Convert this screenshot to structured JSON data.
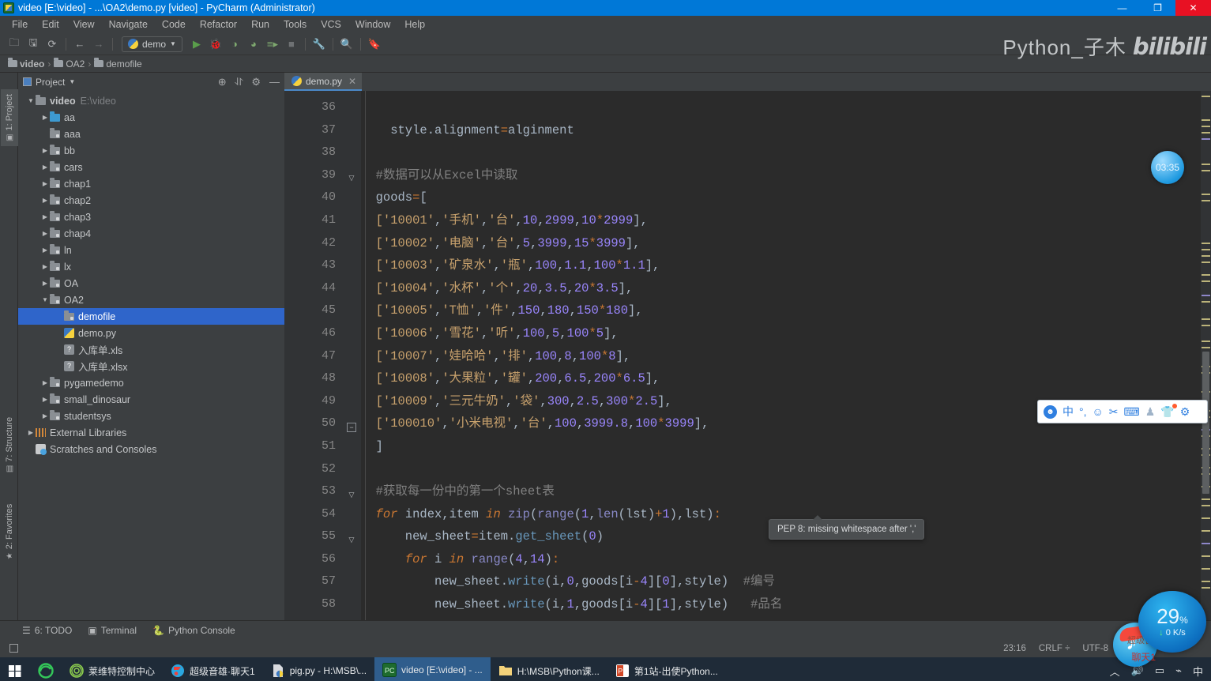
{
  "window": {
    "title": "video [E:\\video] - ...\\OA2\\demo.py [video] - PyCharm (Administrator)",
    "minimize": "—",
    "maximize": "❐",
    "close": "✕"
  },
  "menu": [
    "File",
    "Edit",
    "View",
    "Navigate",
    "Code",
    "Refactor",
    "Run",
    "Tools",
    "VCS",
    "Window",
    "Help"
  ],
  "toolbar": {
    "run_config": "demo",
    "watermark_text": "Python_子木",
    "watermark_brand": "bilibili",
    "icons": [
      "open-folder-icon",
      "save-icon",
      "sync-icon",
      "back-arrow-icon",
      "forward-arrow-icon",
      "run-icon",
      "debug-icon",
      "run-coverage-icon",
      "profile-icon",
      "run-dashboard-icon",
      "stop-icon",
      "settings-wrench-icon",
      "search-icon",
      "toggle-bookmark-icon"
    ]
  },
  "breadcrumb": [
    "video",
    "OA2",
    "demofile"
  ],
  "left_rail": [
    {
      "label": "1: Project",
      "active": true
    },
    {
      "label": "7: Structure",
      "active": false
    },
    {
      "label": "2: Favorites",
      "active": false
    }
  ],
  "project": {
    "panel_title": "Project",
    "header_icons": [
      "locate-icon",
      "collapse-all-icon",
      "gear-icon",
      "hide-icon"
    ],
    "tree": [
      {
        "label": "video",
        "hint": "E:\\video",
        "depth": 0,
        "arrow": "▼",
        "icon": "folder",
        "bold": true
      },
      {
        "label": "aa",
        "depth": 1,
        "arrow": "▶",
        "icon": "folder-blue"
      },
      {
        "label": "aaa",
        "depth": 1,
        "arrow": "",
        "icon": "folder-module"
      },
      {
        "label": "bb",
        "depth": 1,
        "arrow": "▶",
        "icon": "folder-module"
      },
      {
        "label": "cars",
        "depth": 1,
        "arrow": "▶",
        "icon": "folder-module"
      },
      {
        "label": "chap1",
        "depth": 1,
        "arrow": "▶",
        "icon": "folder-module"
      },
      {
        "label": "chap2",
        "depth": 1,
        "arrow": "▶",
        "icon": "folder-module"
      },
      {
        "label": "chap3",
        "depth": 1,
        "arrow": "▶",
        "icon": "folder-module"
      },
      {
        "label": "chap4",
        "depth": 1,
        "arrow": "▶",
        "icon": "folder-module"
      },
      {
        "label": "ln",
        "depth": 1,
        "arrow": "▶",
        "icon": "folder-module"
      },
      {
        "label": "lx",
        "depth": 1,
        "arrow": "▶",
        "icon": "folder-module"
      },
      {
        "label": "OA",
        "depth": 1,
        "arrow": "▶",
        "icon": "folder-module"
      },
      {
        "label": "OA2",
        "depth": 1,
        "arrow": "▼",
        "icon": "folder-module"
      },
      {
        "label": "demofile",
        "depth": 2,
        "arrow": "",
        "icon": "folder-module",
        "selected": true
      },
      {
        "label": "demo.py",
        "depth": 2,
        "arrow": "",
        "icon": "python-file"
      },
      {
        "label": "入库单.xls",
        "depth": 2,
        "arrow": "",
        "icon": "unknown-file"
      },
      {
        "label": "入库单.xlsx",
        "depth": 2,
        "arrow": "",
        "icon": "unknown-file"
      },
      {
        "label": "pygamedemo",
        "depth": 1,
        "arrow": "▶",
        "icon": "folder-module"
      },
      {
        "label": "small_dinosaur",
        "depth": 1,
        "arrow": "▶",
        "icon": "folder-module"
      },
      {
        "label": "studentsys",
        "depth": 1,
        "arrow": "▶",
        "icon": "folder-module"
      },
      {
        "label": "External Libraries",
        "depth": 0,
        "arrow": "▶",
        "icon": "library"
      },
      {
        "label": "Scratches and Consoles",
        "depth": 0,
        "arrow": "",
        "icon": "scratches"
      }
    ]
  },
  "editor": {
    "tab": {
      "label": "demo.py",
      "close": "✕"
    },
    "first_line": 36,
    "tooltip": "PEP 8: missing whitespace after ','",
    "timer_badge": "03:35",
    "lines": [
      {
        "no": 36,
        "html": ""
      },
      {
        "no": 37,
        "html": "    style.alignment<span class=\"eq\">=</span>alginment"
      },
      {
        "no": 38,
        "html": ""
      },
      {
        "no": 39,
        "html": "  <span class=\"cm\">#数据可以从Excel中读取</span>"
      },
      {
        "no": 40,
        "html": "  goods<span class=\"eq\">=</span>["
      },
      {
        "no": 41,
        "html": "  <span class=\"s\">[&#39;10001&#39;</span>,<span class=\"s\">&#39;手机&#39;</span>,<span class=\"s\">&#39;台&#39;</span>,<span class=\"n\">10</span>,<span class=\"n\">2999</span>,<span class=\"n\">10</span><span class=\"op\">*</span><span class=\"n\">2999</span>],"
      },
      {
        "no": 42,
        "html": "  <span class=\"s\">[&#39;10002&#39;</span>,<span class=\"s\">&#39;电脑&#39;</span>,<span class=\"s\">&#39;台&#39;</span>,<span class=\"n\">5</span>,<span class=\"n\">3999</span>,<span class=\"n\">15</span><span class=\"op\">*</span><span class=\"n\">3999</span>],"
      },
      {
        "no": 43,
        "html": "  <span class=\"s\">[&#39;10003&#39;</span>,<span class=\"s\">&#39;矿泉水&#39;</span>,<span class=\"s\">&#39;瓶&#39;</span>,<span class=\"n\">100</span>,<span class=\"n\">1.1</span>,<span class=\"n\">100</span><span class=\"op\">*</span><span class=\"n\">1.1</span>],"
      },
      {
        "no": 44,
        "html": "  <span class=\"s\">[&#39;10004&#39;</span>,<span class=\"s\">&#39;水杯&#39;</span>,<span class=\"s\">&#39;个&#39;</span>,<span class=\"n\">20</span>,<span class=\"n\">3.5</span>,<span class=\"n\">20</span><span class=\"op\">*</span><span class=\"n\">3.5</span>],"
      },
      {
        "no": 45,
        "html": "  <span class=\"s\">[&#39;10005&#39;</span>,<span class=\"s\">&#39;T恤&#39;</span>,<span class=\"s\">&#39;件&#39;</span>,<span class=\"n\">150</span>,<span class=\"n\">180</span>,<span class=\"n\">150</span><span class=\"op\">*</span><span class=\"n\">180</span>],"
      },
      {
        "no": 46,
        "html": "  <span class=\"s\">[&#39;10006&#39;</span>,<span class=\"s\">&#39;雪花&#39;</span>,<span class=\"s\">&#39;听&#39;</span>,<span class=\"n\">100</span>,<span class=\"n\">5</span>,<span class=\"n\">100</span><span class=\"op\">*</span><span class=\"n\">5</span>],"
      },
      {
        "no": 47,
        "html": "  <span class=\"s\">[&#39;10007&#39;</span>,<span class=\"s\">&#39;娃哈哈&#39;</span>,<span class=\"s\">&#39;排&#39;</span>,<span class=\"n\">100</span>,<span class=\"n\">8</span>,<span class=\"n\">100</span><span class=\"op\">*</span><span class=\"n\">8</span>],"
      },
      {
        "no": 48,
        "html": "  <span class=\"s\">[&#39;10008&#39;</span>,<span class=\"s\">&#39;大果粒&#39;</span>,<span class=\"s\">&#39;罐&#39;</span>,<span class=\"n\">200</span>,<span class=\"n\">6.5</span>,<span class=\"n\">200</span><span class=\"op\">*</span><span class=\"n\">6.5</span>],"
      },
      {
        "no": 49,
        "html": "  <span class=\"s\">[&#39;10009&#39;</span>,<span class=\"s\">&#39;三元牛奶&#39;</span>,<span class=\"s\">&#39;袋&#39;</span>,<span class=\"n\">300</span>,<span class=\"n\">2.5</span>,<span class=\"n\">300</span><span class=\"op\">*</span><span class=\"n\">2.5</span>],"
      },
      {
        "no": 50,
        "html": "  <span class=\"s\">[&#39;100010&#39;</span>,<span class=\"s\">&#39;小米电视&#39;</span>,<span class=\"s\">&#39;台&#39;</span>,<span class=\"n\">100</span>,<span class=\"n\">3999.8</span>,<span class=\"n\">100</span><span class=\"op\">*</span><span class=\"n\">3999</span>],"
      },
      {
        "no": 51,
        "html": "  ]"
      },
      {
        "no": 52,
        "html": ""
      },
      {
        "no": 53,
        "html": "  <span class=\"cm\">#获取每一份中的第一个sheet表</span>"
      },
      {
        "no": 54,
        "html": "  <span class=\"kw\">for</span> index,item <span class=\"kw\">in</span> <span class=\"bi\">zip</span>(<span class=\"bi\">range</span>(<span class=\"n\">1</span>,<span class=\"bi\">len</span>(lst)<span class=\"op\">+</span><span class=\"n\">1</span>),lst)<span class=\"op\">:</span>"
      },
      {
        "no": 55,
        "html": "      new_sheet<span class=\"eq\">=</span>item.<span class=\"fn\">get_sheet</span>(<span class=\"n\">0</span>)"
      },
      {
        "no": 56,
        "html": "      <span class=\"kw\">for</span> i <span class=\"kw\">in</span> <span class=\"bi\">range</span>(<span class=\"n\">4</span>,<span class=\"n\">14</span>)<span class=\"op\">:</span>"
      },
      {
        "no": 57,
        "html": "          new_sheet.<span class=\"fn\">write</span>(i,<span class=\"n\">0</span>,goods[i<span class=\"op\">-</span><span class=\"n\">4</span>][<span class=\"n\">0</span>],style)  <span class=\"cm\">#编号</span>"
      },
      {
        "no": 58,
        "html": "          new_sheet.<span class=\"fn\">write</span>(i,<span class=\"n\">1</span>,goods[i<span class=\"op\">-</span><span class=\"n\">4</span>][<span class=\"n\">1</span>],style)   <span class=\"cm\">#品名</span>"
      }
    ]
  },
  "bottom_tools": [
    {
      "label": "6: TODO",
      "icon": "todo-icon"
    },
    {
      "label": "Terminal",
      "icon": "terminal-icon"
    },
    {
      "label": "Python Console",
      "icon": "python-icon"
    }
  ],
  "status": {
    "time": "23:16",
    "line_sep": "CRLF",
    "encoding": "UTF-8",
    "sep_arrows": "÷"
  },
  "ime_toolbar": {
    "icons": [
      "sogou-logo-icon",
      "chinese-mode-icon",
      "punctuation-icon",
      "emoji-icon",
      "scissors-icon",
      "keyboard-icon",
      "user-icon",
      "skin-shirt-icon",
      "gear-icon"
    ],
    "chinese_label": "中"
  },
  "overlays": {
    "net_percent": "29",
    "net_percent_unit": "%",
    "net_speed": "0 K/s",
    "chat_label": "聊天1",
    "super_label": "超级音雄"
  },
  "taskbar": {
    "items": [
      {
        "label": "",
        "icon": "windows-start-icon",
        "type": "start"
      },
      {
        "label": "",
        "icon": "edge-browser-icon",
        "type": "icon"
      },
      {
        "label": "莱维特控制中心",
        "icon": "lewitt-icon",
        "type": "app"
      },
      {
        "label": "超级音雄·聊天1",
        "icon": "music-chat-icon",
        "type": "app"
      },
      {
        "label": "pig.py - H:\\MSB\\...",
        "icon": "python-file-icon",
        "type": "app"
      },
      {
        "label": "video [E:\\video] - ...",
        "icon": "pycharm-icon",
        "type": "app",
        "active": true
      },
      {
        "label": "H:\\MSB\\Python课...",
        "icon": "folder-icon",
        "type": "app"
      },
      {
        "label": "第1站-出使Python...",
        "icon": "powerpoint-icon",
        "type": "app"
      }
    ],
    "tray": [
      "chevron-up-icon",
      "volume-icon",
      "battery-icon",
      "wifi-icon",
      "ime-chinese-icon"
    ]
  }
}
